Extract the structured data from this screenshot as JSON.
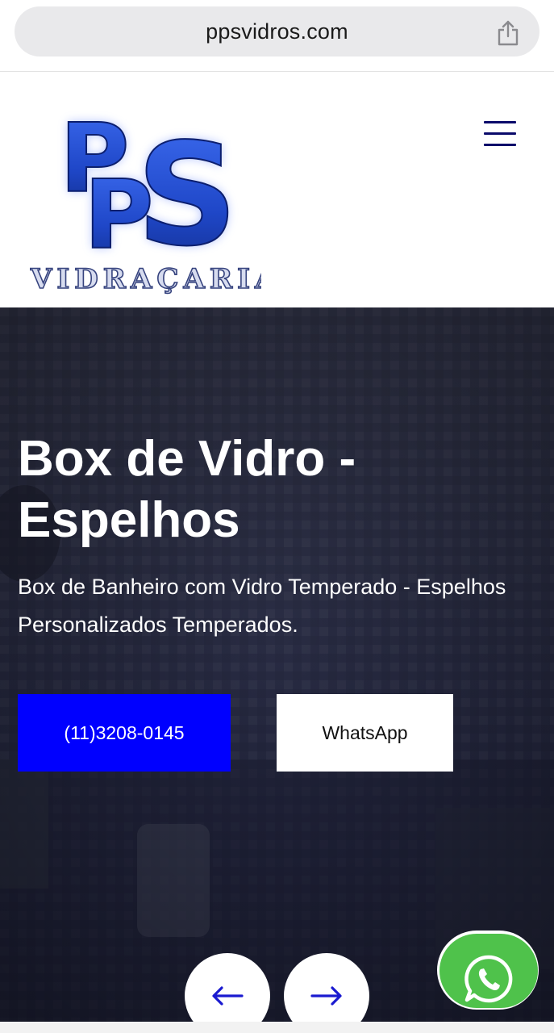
{
  "browser": {
    "url": "ppsvidros.com",
    "share_icon": "share-icon"
  },
  "header": {
    "logo_letters": "PPS",
    "logo_subtitle": "VIDRAÇARIA",
    "menu_icon": "hamburger-menu-icon",
    "menu_color": "#0a0a6a"
  },
  "hero": {
    "title": "Box de Vidro - Espelhos",
    "subtitle": "Box de Banheiro com Vidro Temperado - Espelhos Personalizados Temperados.",
    "phone_button_label": "(11)3208-0145",
    "whatsapp_button_label": "WhatsApp",
    "phone_button_color": "#0000ff",
    "prev_icon": "arrow-left-icon",
    "next_icon": "arrow-right-icon",
    "arrow_color": "#1a1ad0"
  },
  "floating": {
    "whatsapp_icon": "whatsapp-icon",
    "color": "#4fc24b"
  }
}
